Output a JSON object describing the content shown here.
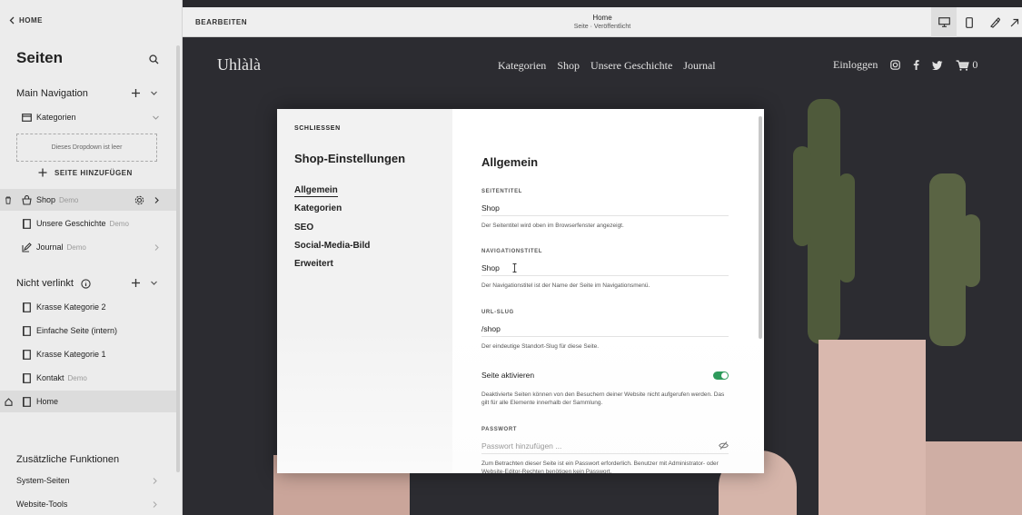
{
  "sidebar": {
    "home_label": "HOME",
    "title": "Seiten",
    "main_nav": {
      "label": "Main Navigation",
      "items": [
        {
          "label": "Kategorien",
          "demo": ""
        }
      ],
      "empty_dropdown": "Dieses Dropdown ist leer",
      "add_page": "SEITE HINZUFÜGEN",
      "pages": [
        {
          "label": "Shop",
          "demo": "Demo"
        },
        {
          "label": "Unsere Geschichte",
          "demo": "Demo"
        },
        {
          "label": "Journal",
          "demo": "Demo"
        }
      ]
    },
    "not_linked": {
      "label": "Nicht verlinkt",
      "items": [
        {
          "label": "Krasse Kategorie 2",
          "demo": ""
        },
        {
          "label": "Einfache Seite (intern)",
          "demo": ""
        },
        {
          "label": "Krasse Kategorie 1",
          "demo": ""
        },
        {
          "label": "Kontakt",
          "demo": "Demo"
        },
        {
          "label": "Home",
          "demo": ""
        }
      ]
    },
    "extra": {
      "label": "Zusätzliche Funktionen",
      "items": [
        {
          "label": "System-Seiten"
        },
        {
          "label": "Website-Tools"
        }
      ]
    }
  },
  "topbar": {
    "edit_label": "BEARBEITEN",
    "page_name": "Home",
    "page_status": "Seite · Veröffentlicht"
  },
  "site": {
    "logo": "Uhlàlà",
    "nav": [
      "Kategorien",
      "Shop",
      "Unsere Geschichte",
      "Journal"
    ],
    "login": "Einloggen",
    "cart_count": "0"
  },
  "modal": {
    "close_label": "SCHLIESSEN",
    "title": "Shop-Einstellungen",
    "menu": [
      "Allgemein",
      "Kategorien",
      "SEO",
      "Social-Media-Bild",
      "Erweitert"
    ],
    "content_title": "Allgemein",
    "fields": {
      "page_title": {
        "label": "SEITENTITEL",
        "value": "Shop",
        "help": "Der Seitentitel wird oben im Browserfenster angezeigt."
      },
      "nav_title": {
        "label": "NAVIGATIONSTITEL",
        "value": "Shop",
        "help": "Der Navigationstitel ist der Name der Seite im Navigationsmenü."
      },
      "url_slug": {
        "label": "URL-SLUG",
        "value": "/shop",
        "help": "Der eindeutige Standort-Slug für diese Seite."
      },
      "enable_page": {
        "label": "Seite aktivieren",
        "help": "Deaktivierte Seiten können von den Besuchern deiner Website nicht aufgerufen werden. Das gilt für alle Elemente innerhalb der Sammlung."
      },
      "password": {
        "label": "PASSWORT",
        "placeholder": "Passwort hinzufügen ...",
        "help": "Zum Betrachten dieser Seite ist ein Passwort erforderlich. Benutzer mit Administrator- oder Website-Editor-Rechten benötigen kein Passwort."
      }
    }
  },
  "colors": {
    "toggle_on": "#2e9a5b",
    "site_bg": "#2c2c31",
    "pot": "#d9b8ae"
  }
}
